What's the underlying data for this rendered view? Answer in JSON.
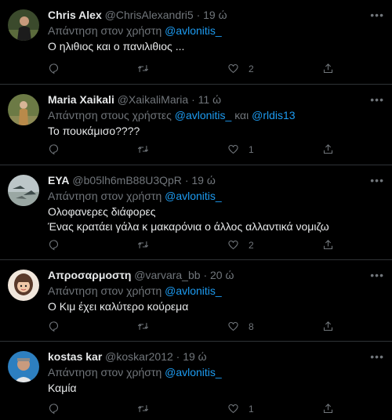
{
  "replies": [
    {
      "name": "Chris Alex",
      "handle": "@ChrisAlexandri5",
      "sep": "·",
      "time": "19 ώ",
      "reply_prefix": "Απάντηση στον χρήστη",
      "mentions": [
        "@avlonitis_"
      ],
      "mention_join": "",
      "text_lines": [
        "Ο ηλιθιος και ο πανιλιθιος ..."
      ],
      "likes": "2",
      "avatar_bg": "#3b4a2c"
    },
    {
      "name": "Maria Xaikali",
      "handle": "@XaikaliMaria",
      "sep": "·",
      "time": "11 ώ",
      "reply_prefix": "Απάντηση στους χρήστες",
      "mentions": [
        "@avlonitis_",
        "@rldis13"
      ],
      "mention_join": "και",
      "text_lines": [
        "Το πουκάμισο????"
      ],
      "likes": "1",
      "avatar_bg": "#6c7a45"
    },
    {
      "name": "ΕΥΑ",
      "handle": "@b05lh6mB88U3QpR",
      "sep": "·",
      "time": "19 ώ",
      "reply_prefix": "Απάντηση στον χρήστη",
      "mentions": [
        "@avlonitis_"
      ],
      "mention_join": "",
      "text_lines": [
        "Ολοφανερες διάφορες",
        "Ένας κρατάει γάλα κ μακαρόνια ο άλλος αλλαντικά νομιζω"
      ],
      "likes": "2",
      "avatar_bg": "#bcc6c8"
    },
    {
      "name": "Απροσαρμοστη",
      "handle": "@varvara_bb",
      "sep": "·",
      "time": "20 ώ",
      "reply_prefix": "Απάντηση στον χρήστη",
      "mentions": [
        "@avlonitis_"
      ],
      "mention_join": "",
      "text_lines": [
        "Ο Κιμ έχει καλύτερο κούρεμα"
      ],
      "likes": "8",
      "avatar_bg": "#f1e7dc"
    },
    {
      "name": "kostas kar",
      "handle": "@koskar2012",
      "sep": "·",
      "time": "19 ώ",
      "reply_prefix": "Απάντηση στον χρήστη",
      "mentions": [
        "@avlonitis_"
      ],
      "mention_join": "",
      "text_lines": [
        "Καμία"
      ],
      "likes": "1",
      "avatar_bg": "#2d7fc0"
    }
  ],
  "colors": {
    "background": "#000000",
    "text": "#e7e9ea",
    "muted": "#71767b",
    "link": "#1d9bf0",
    "divider": "#2f3336"
  }
}
